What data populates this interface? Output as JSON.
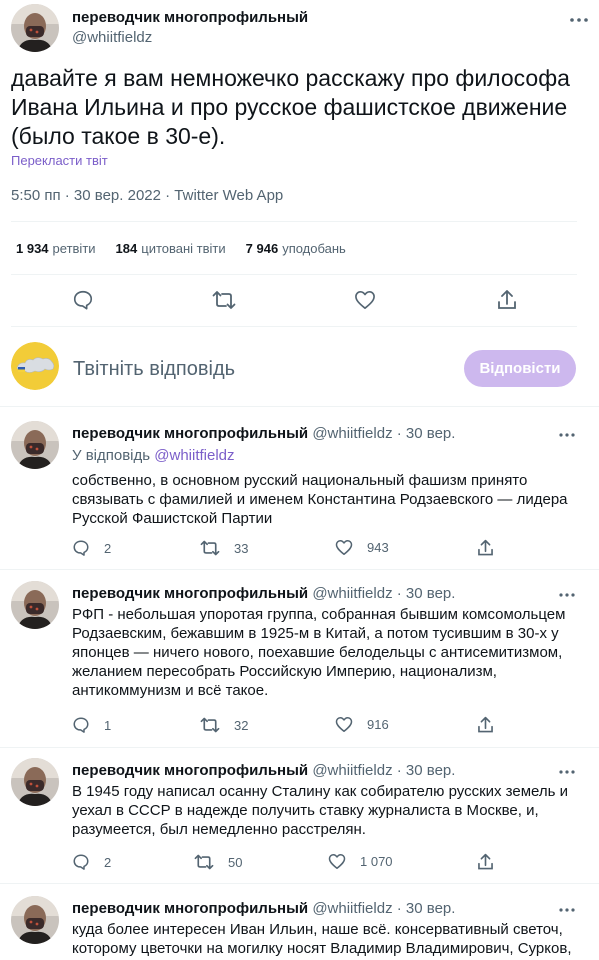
{
  "tweet": {
    "author_name": "переводчик многопрофильный",
    "author_handle": "@whiitfieldz",
    "text": "давайте я вам немножечко расскажу про философа Ивана Ильина и про русское фашистское движение (было такое в 30-е).",
    "translate_label": "Перекласти твіт",
    "meta": "5:50 пп · 30 вер. 2022 · Twitter Web App",
    "stats": [
      {
        "count": "1 934",
        "label": "ретвіти"
      },
      {
        "count": "184",
        "label": "цитовані твіти"
      },
      {
        "count": "7 946",
        "label": "уподобань"
      }
    ]
  },
  "composer": {
    "placeholder": "Твітніть відповідь",
    "button_label": "Відповісти"
  },
  "replies": [
    {
      "name": "переводчик многопрофильный",
      "handle": "@whiitfieldz",
      "date": "30 вер.",
      "reply_prefix": "У відповідь",
      "reply_to": "@whiitfieldz",
      "text": "собственно, в основном русский национальный фашизм принято связывать с фамилией и именем Константина Родзаевского — лидера Русской Фашистской Партии",
      "replies_count": "2",
      "retweets_count": "33",
      "likes_count": "943"
    },
    {
      "name": "переводчик многопрофильный",
      "handle": "@whiitfieldz",
      "date": "30 вер.",
      "text": "РФП - небольшая упоротая группа, собранная бывшим комсомольцем Родзаевским, бежавшим в 1925-м в Китай, а потом тусившим в 30-х у японцев — ничего нового, поехавшие белодельцы с антисемитизмом, желанием пересобрать Российскую Империю, национализм, антикоммунизм и всё такое.",
      "replies_count": "1",
      "retweets_count": "32",
      "likes_count": "916"
    },
    {
      "name": "переводчик многопрофильный",
      "handle": "@whiitfieldz",
      "date": "30 вер.",
      "text": "В 1945 году написал осанну Сталину как собирателю русских земель и уехал в СССР в надежде получить ставку журналиста в Москве, и, разумеется, был немедленно расстрелян.",
      "replies_count": "2",
      "retweets_count": "50",
      "likes_count": "1 070"
    },
    {
      "name": "переводчик многопрофильный",
      "handle": "@whiitfieldz",
      "date": "30 вер.",
      "text": "куда более интересен Иван Ильин, наше всё. консервативный светоч, которому цветочки на могилку носят Владимир Владимирович, Сурков,"
    }
  ],
  "separator": "·",
  "icons": {
    "reply": "reply-icon",
    "retweet": "retweet-icon",
    "like": "heart-icon",
    "share": "share-icon",
    "more": "more-icon"
  },
  "colors": {
    "accent": "#7b5ec9",
    "button_disabled": "#cdb8ee",
    "muted": "#536471",
    "text": "#0f1419",
    "divider": "#eff3f4"
  }
}
